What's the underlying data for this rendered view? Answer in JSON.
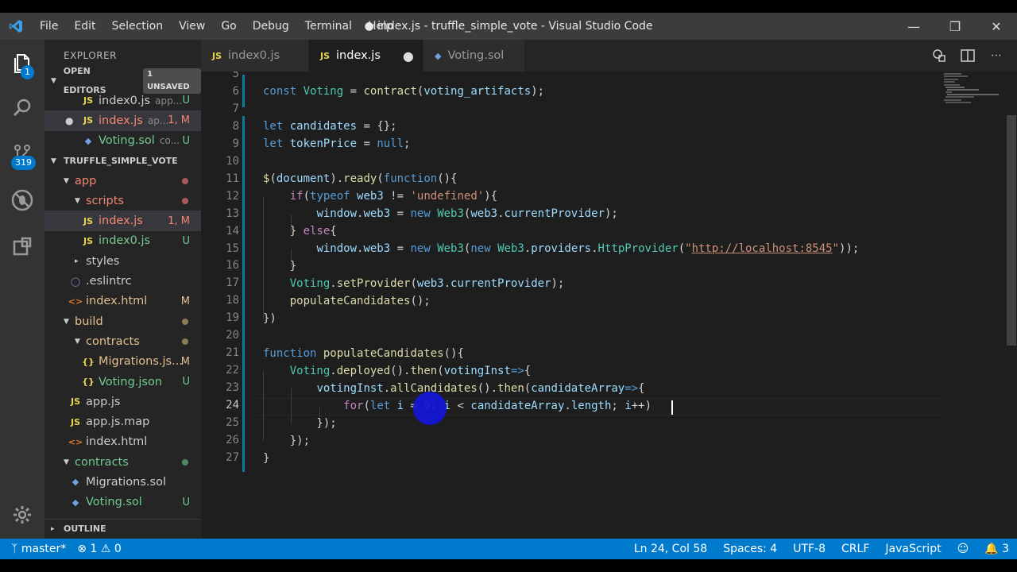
{
  "window": {
    "title": "● index.js - truffle_simple_vote - Visual Studio Code",
    "menu": [
      "File",
      "Edit",
      "Selection",
      "View",
      "Go",
      "Debug",
      "Terminal",
      "Help"
    ],
    "controls": [
      "minimize",
      "restore",
      "close"
    ]
  },
  "activity": {
    "explorer_badge": "1",
    "scm_badge": "319"
  },
  "sidebar": {
    "header": "EXPLORER",
    "open_editors": {
      "label": "OPEN EDITORS",
      "count": "1 UNSAVED"
    },
    "open_files": [
      {
        "icon": "JS",
        "name": "index0.js",
        "desc": "app...",
        "status": "U"
      },
      {
        "icon": "JS",
        "name": "index.js",
        "desc": "ap...",
        "status": "1, M",
        "dirty": true
      },
      {
        "icon": "sol-icon",
        "name": "Voting.sol",
        "desc": "co...",
        "status": "U"
      }
    ],
    "project": "TRUFFLE_SIMPLE_VOTE",
    "tree": [
      {
        "label": "app",
        "kind": "folder"
      },
      {
        "label": "scripts",
        "kind": "folder"
      },
      {
        "label": "index.js",
        "status": "1, M"
      },
      {
        "label": "index0.js",
        "status": "U"
      },
      {
        "label": "styles",
        "kind": "folder"
      },
      {
        "label": ".eslintrc"
      },
      {
        "label": "index.html",
        "status": "M"
      },
      {
        "label": "build",
        "kind": "folder"
      },
      {
        "label": "contracts",
        "kind": "folder"
      },
      {
        "label": "Migrations.js...",
        "status": "M"
      },
      {
        "label": "Voting.json",
        "status": "U"
      },
      {
        "label": "app.js"
      },
      {
        "label": "app.js.map"
      },
      {
        "label": "index.html"
      },
      {
        "label": "contracts",
        "kind": "folder"
      },
      {
        "label": "Migrations.sol"
      },
      {
        "label": "Voting.sol",
        "status": "U"
      }
    ],
    "outline": "OUTLINE"
  },
  "tabs": [
    {
      "icon": "JS",
      "label": "index0.js",
      "active": false
    },
    {
      "icon": "JS",
      "label": "index.js",
      "active": true,
      "dirty": "●"
    },
    {
      "icon": "sol-icon",
      "label": "Voting.sol",
      "active": false
    }
  ],
  "editor": {
    "line_numbers": [
      "5",
      "6",
      "7",
      "8",
      "9",
      "10",
      "11",
      "12",
      "13",
      "14",
      "15",
      "16",
      "17",
      "18",
      "19",
      "20",
      "21",
      "22",
      "23",
      "24",
      "25",
      "26",
      "27"
    ],
    "current_line": "24"
  },
  "status": {
    "branch": "master*",
    "errors": "1",
    "warnings": "0",
    "position": "Ln 24, Col 58",
    "spaces": "Spaces: 4",
    "encoding": "UTF-8",
    "eol": "CRLF",
    "language": "JavaScript",
    "notifications": "3"
  }
}
